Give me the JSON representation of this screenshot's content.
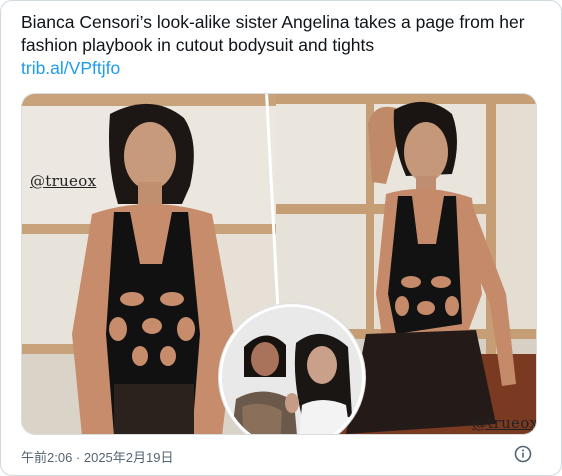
{
  "tweet": {
    "text": "Bianca Censori’s look-alike sister Angelina takes a page from her fashion playbook in cutout bodysuit and tights",
    "link": "trib.al/VPftjfo",
    "timestamp": "午前2:06 · 2025年2月19日"
  },
  "media": {
    "watermark_left": "@trueox",
    "watermark_right": "@trueox"
  },
  "icons": {
    "info": "info-icon"
  }
}
